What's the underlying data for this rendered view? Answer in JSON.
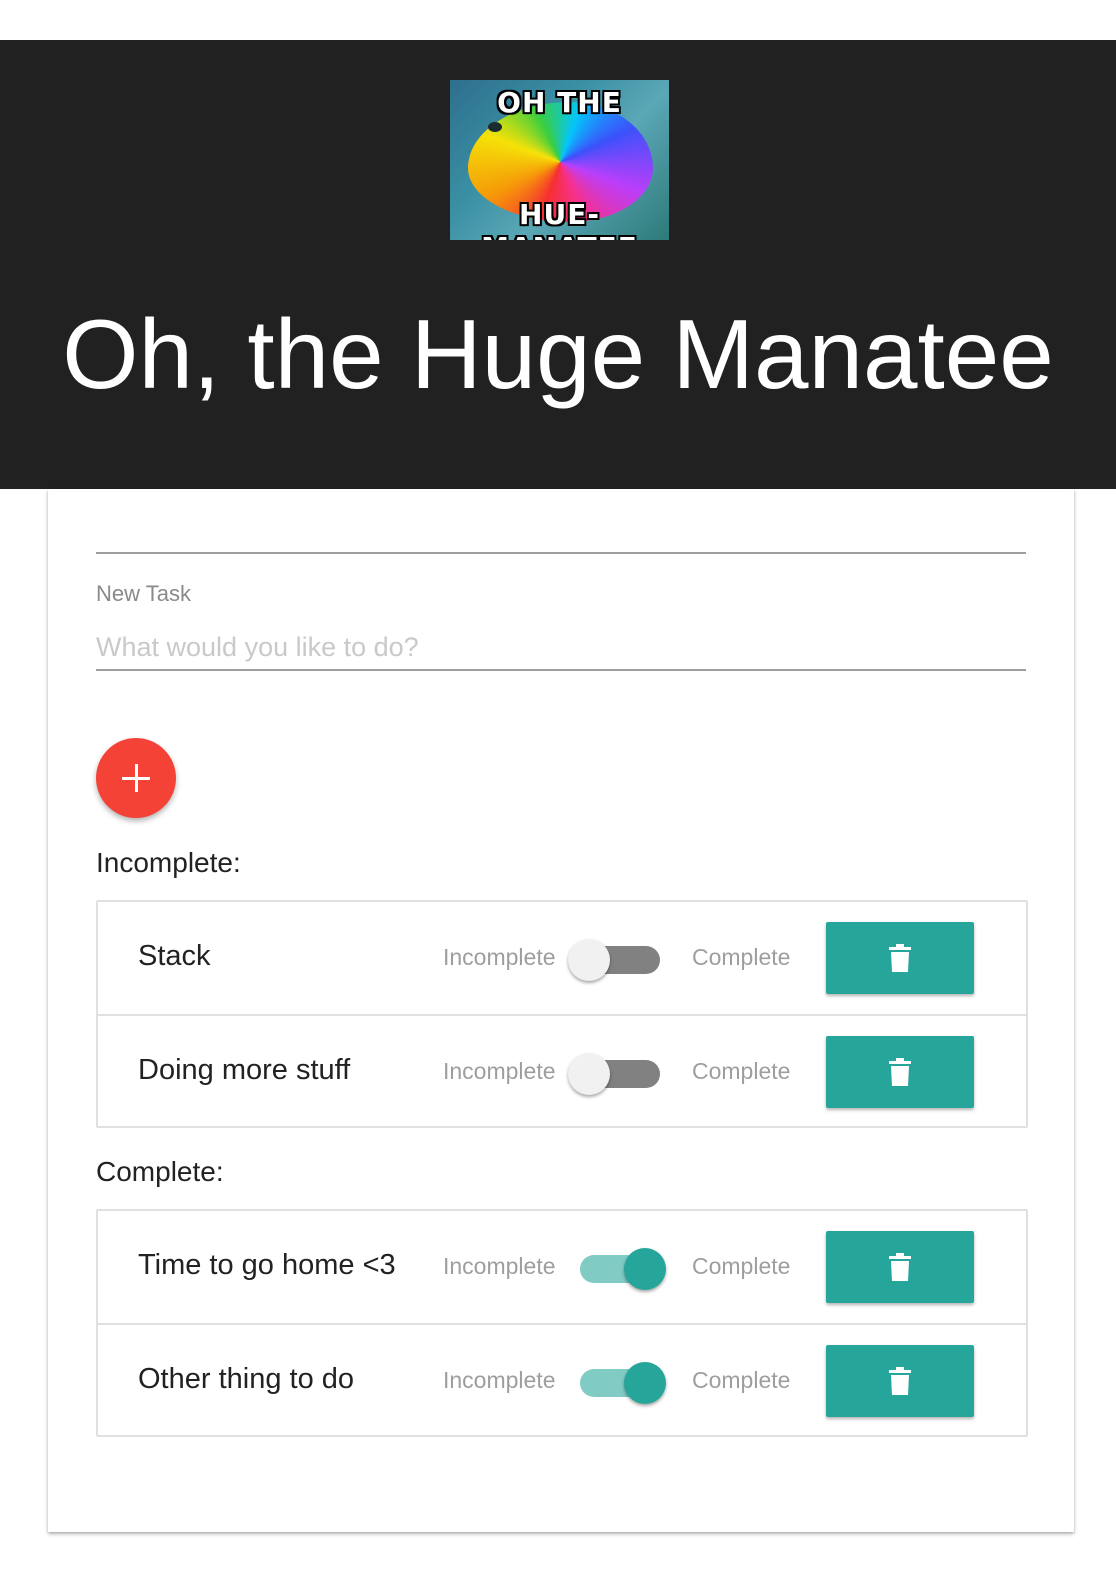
{
  "header": {
    "logo": {
      "top_text": "OH THE",
      "bottom_text": "HUE-MANATEE",
      "icon": "rainbow-manatee-logo"
    },
    "title": "Oh, the Huge Manatee",
    "background_color": "#212121"
  },
  "form": {
    "label": "New Task",
    "placeholder": "What would you like to do?",
    "value": "",
    "add_icon": "plus-icon",
    "add_color": "#f44336"
  },
  "sections": {
    "incomplete": {
      "heading": "Incomplete:",
      "tasks": [
        {
          "name": "Stack",
          "left_label": "Incomplete",
          "right_label": "Complete",
          "complete": false
        },
        {
          "name": "Doing more stuff",
          "left_label": "Incomplete",
          "right_label": "Complete",
          "complete": false
        }
      ]
    },
    "complete": {
      "heading": "Complete:",
      "tasks": [
        {
          "name": "Time to go home <3",
          "left_label": "Incomplete",
          "right_label": "Complete",
          "complete": true
        },
        {
          "name": "Other thing to do",
          "left_label": "Incomplete",
          "right_label": "Complete",
          "complete": true
        }
      ]
    }
  },
  "delete_icon": "trash-icon",
  "accent_color": "#26a69a"
}
